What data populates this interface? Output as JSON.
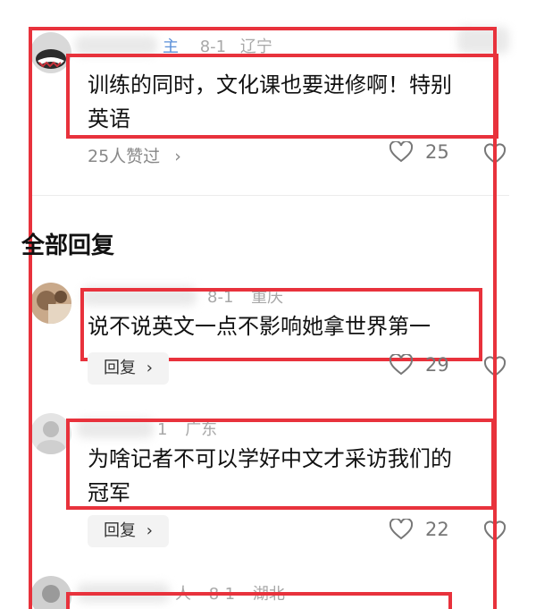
{
  "top_comment": {
    "meta_tag": "主",
    "meta_date": "8-1",
    "meta_location": "辽宁",
    "text_line1": "训练的同时，文化课也要进修啊！特别",
    "text_line2": "英语",
    "likers": "25人赞过",
    "likes": "25"
  },
  "section_title": "全部回复",
  "replies": [
    {
      "meta_date": "8-1",
      "meta_location": "重庆",
      "text_line1": "说不说英文一点不影响她拿世界第一",
      "reply_label": "回复",
      "likes": "29"
    },
    {
      "meta_date": "1",
      "meta_location": "广东",
      "text_line1": "为啥记者不可以学好中文才采访我们的",
      "text_line2": "冠军",
      "reply_label": "回复",
      "likes": "22"
    },
    {
      "meta_prefix": "人",
      "meta_date": "8-1",
      "meta_location": "湖北"
    }
  ],
  "colors": {
    "annotation_red": "#e8323c",
    "text": "#111111",
    "meta": "#a8a8a8"
  }
}
